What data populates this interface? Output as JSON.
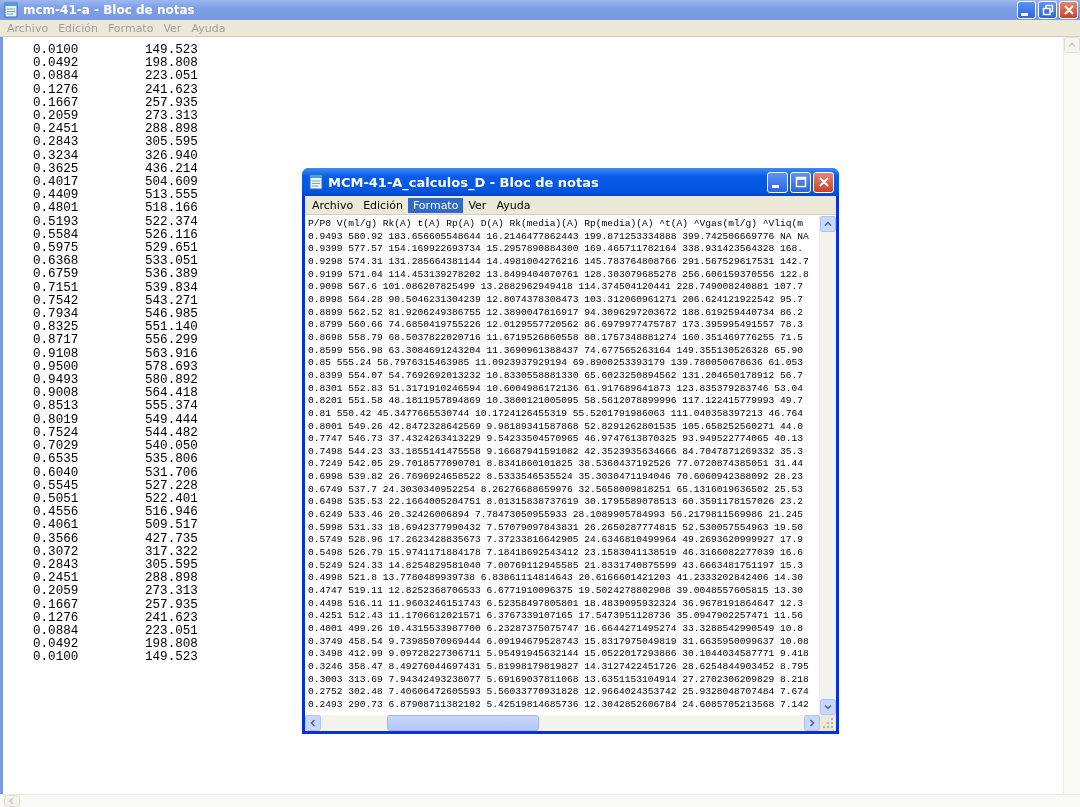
{
  "back_window": {
    "title": "mcm-41-a - Bloc de notas",
    "active": false,
    "maximized": true,
    "menu": [
      {
        "label": "Archivo",
        "selected": false
      },
      {
        "label": "Edición",
        "selected": false
      },
      {
        "label": "Formato",
        "selected": false
      },
      {
        "label": "Ver",
        "selected": false
      },
      {
        "label": "Ayuda",
        "selected": false
      }
    ],
    "rows": [
      [
        "0.0100",
        "149.523"
      ],
      [
        "0.0492",
        "198.808"
      ],
      [
        "0.0884",
        "223.051"
      ],
      [
        "0.1276",
        "241.623"
      ],
      [
        "0.1667",
        "257.935"
      ],
      [
        "0.2059",
        "273.313"
      ],
      [
        "0.2451",
        "288.898"
      ],
      [
        "0.2843",
        "305.595"
      ],
      [
        "0.3234",
        "326.940"
      ],
      [
        "0.3625",
        "436.214"
      ],
      [
        "0.4017",
        "504.609"
      ],
      [
        "0.4409",
        "513.555"
      ],
      [
        "0.4801",
        "518.166"
      ],
      [
        "0.5193",
        "522.374"
      ],
      [
        "0.5584",
        "526.116"
      ],
      [
        "0.5975",
        "529.651"
      ],
      [
        "0.6368",
        "533.051"
      ],
      [
        "0.6759",
        "536.389"
      ],
      [
        "0.7151",
        "539.834"
      ],
      [
        "0.7542",
        "543.271"
      ],
      [
        "0.7934",
        "546.985"
      ],
      [
        "0.8325",
        "551.140"
      ],
      [
        "0.8717",
        "556.299"
      ],
      [
        "0.9108",
        "563.916"
      ],
      [
        "0.9500",
        "578.693"
      ],
      [
        "0.9493",
        "580.892"
      ],
      [
        "0.9008",
        "564.418"
      ],
      [
        "0.8513",
        "555.374"
      ],
      [
        "0.8019",
        "549.444"
      ],
      [
        "0.7524",
        "544.482"
      ],
      [
        "0.7029",
        "540.050"
      ],
      [
        "0.6535",
        "535.806"
      ],
      [
        "0.6040",
        "531.706"
      ],
      [
        "0.5545",
        "527.228"
      ],
      [
        "0.5051",
        "522.401"
      ],
      [
        "0.4556",
        "516.946"
      ],
      [
        "0.4061",
        "509.517"
      ],
      [
        "0.3566",
        "427.735"
      ],
      [
        "0.3072",
        "317.322"
      ],
      [
        "0.2843",
        "305.595"
      ],
      [
        "0.2451",
        "288.898"
      ],
      [
        "0.2059",
        "273.313"
      ],
      [
        "0.1667",
        "257.935"
      ],
      [
        "0.1276",
        "241.623"
      ],
      [
        "0.0884",
        "223.051"
      ],
      [
        "0.0492",
        "198.808"
      ],
      [
        "0.0100",
        "149.523"
      ]
    ]
  },
  "front_window": {
    "title": "MCM-41-A_calculos_D - Bloc de notas",
    "active": true,
    "maximized": false,
    "menu": [
      {
        "label": "Archivo",
        "selected": false
      },
      {
        "label": "Edición",
        "selected": false
      },
      {
        "label": "Formato",
        "selected": true
      },
      {
        "label": "Ver",
        "selected": false
      },
      {
        "label": "Ayuda",
        "selected": false
      }
    ],
    "lines": [
      "P/P0 V(ml/g) Rk(A) t(A) Rp(A) D(A) Rk(media)(A) Rp(media)(A) ^t(A) ^Vgas(ml/g) ^Vliq(m",
      "0.9493 580.92 183.656605548644 16.2146477862443 199.871253334888 399.742506669776 NA NA",
      "0.9399 577.57 154.169922693734 15.2957890884300 169.465711782164 338.931423564328 168.",
      "0.9298 574.31 131.285664381144 14.4981004276216 145.783764808766 291.567529617531 142.7",
      "0.9199 571.04 114.453139278202 13.8499404070761 128.303079685278 256.606159370556 122.8",
      "0.9098 567.6 101.086207825499 13.2882962949418 114.374504120441 228.749008240881 107.7",
      "0.8998 564.28 90.5046231304239 12.8074378308473 103.312060961271 206.624121922542 95.7",
      "0.8899 562.52 81.9206249386755 12.3890047816917 94.3096297203672 188.619259440734 86.2",
      "0.8799 560.66 74.6850419755226 12.0129557720562 86.6979977475787 173.395995491557 78.3",
      "0.8698 558.79 68.5037822020716 11.6719526860558 80.1757348881274 160.351469776255 71.5",
      "0.8599 556.98 63.3084691243204 11.3690961388437 74.677565263164 149.355130526328 65.90",
      "0.85 555.24 58.7976315463985 11.0923937929194 69.8900253393179 139.780050678636 61.053",
      "0.8399 554.07 54.7692692013232 10.8330558881330 65.6023250894562 131.204650178912 56.7",
      "0.8301 552.83 51.3171910246594 10.6004986172136 61.917689641873 123.835379283746 53.04",
      "0.8201 551.58 48.1811957894869 10.3800121005095 58.5612078899996 117.122415779993 49.7",
      "0.81 550.42 45.3477665530744 10.1724126455319 55.5201791986063 111.040358397213 46.764",
      "0.8001 549.26 42.8472328642569 9.98189341587868 52.8291262801535 105.658252560271 44.0",
      "0.7747 546.73 37.4324263413229 9.54233504570965 46.9747613870325 93.949522774065 40.13",
      "0.7498 544.23 33.1855141475558 9.16687941591082 42.3523935634666 84.7047871269332 35.3",
      "0.7249 542.05 29.7018577090701 8.8341860101825 38.5360437192526 77.0720874385051 31.44",
      "0.6998 539.82 26.7696924658522 8.5333546535524 35.3030471194046 70.6060942388092 28.23",
      "0.6749 537.7 24.3030340952254 8.26276688659976 32.5658009818251 65.1316019636502 25.53",
      "0.6498 535.53 22.1664005204751 8.01315838737619 30.1795589078513 60.3591178157026 23.2",
      "0.6249 533.46 20.32426006894 7.78473050955933 28.1089905784993 56.2179811569986 21.245",
      "0.5998 531.33 18.6942377990432 7.57079097843831 26.2650287774815 52.530057554963 19.50",
      "0.5749 528.96 17.2623428835673 7.37233816642905 24.6346810499964 49.2693620999927 17.9",
      "0.5498 526.79 15.9741171884178 7.18418692543412 23.1583041138519 46.3166082277039 16.6",
      "0.5249 524.33 14.8254829581040 7.00769112945585 21.8331740875599 43.6663481751197 15.3",
      "0.4998 521.8 13.7780489939738 6.83861114814643 20.6166601421203 41.2333202842406 14.30",
      "0.4747 519.11 12.8252368706533 6.6771910096375 19.5024278802908 39.0048557605815 13.30",
      "0.4498 516.11 11.9603246151743 6.52358497805801 18.4839095932324 36.9678191864647 12.3",
      "0.4251 512.43 11.1706612021571 6.3767339107165 17.5473951128736 35.0947902257471 11.56",
      "0.4001 499.26 10.4315533987700 6.23287375075747 16.6644271495274 33.3288542990549 10.8",
      "0.3749 458.54 9.73985070969444 6.09194679528743 15.8317975049819 31.6635950099637 10.08",
      "0.3498 412.99 9.09728227306711 5.95491945632144 15.0522017293886 30.1044034587771 9.418",
      "0.3246 358.47 8.49276044697431 5.81998179819827 14.3127422451726 28.6254844903452 8.795",
      "0.3003 313.69 7.94342493238077 5.69169037811068 13.6351153104914 27.2702306209829 8.218",
      "0.2752 302.48 7.40606472605593 5.56033770931828 12.9664024353742 25.9328048707484 7.674",
      "0.2493 290.73 6.87908711382102 5.42519814685736 12.3042852606784 24.6085705213568 7.142"
    ]
  }
}
